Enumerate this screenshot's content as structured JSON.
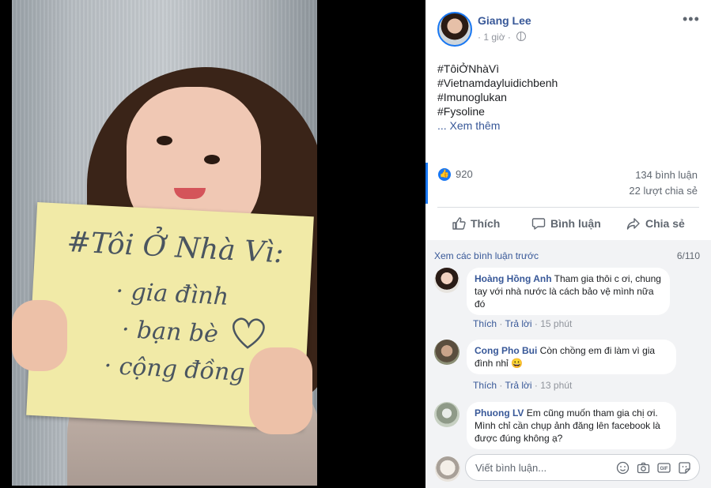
{
  "photo": {
    "sign_lines": [
      "#Tôi Ở Nhà Vì:",
      "· gia đình",
      "· bạn bè",
      "· cộng đồng"
    ]
  },
  "post": {
    "author": "Giang Lee",
    "time": "1 giờ",
    "more_icon": "more-horizontal-icon",
    "hashtags": [
      "#TôiỞNhàVì",
      "#Vietnamdayluidichbenh",
      "#Imunoglukan",
      "#Fysoline"
    ],
    "see_more": "... Xem thêm",
    "reaction_count": "920",
    "comment_count": "134 bình luận",
    "share_count": "22 lượt chia sẻ"
  },
  "actions": {
    "like": "Thích",
    "comment": "Bình luận",
    "share": "Chia sẻ"
  },
  "comments": {
    "view_previous": "Xem các bình luận trước",
    "page_indicator": "6/110",
    "items": [
      {
        "name": "Hoàng Hồng Anh",
        "text": "Tham gia thôi c ơi, chung tay với nhà nước là cách bảo vệ mình nữa đó",
        "like": "Thích",
        "reply": "Trả lời",
        "time": "15 phút"
      },
      {
        "name": "Cong Pho Bui",
        "text": "Còn chồng em đi làm vì gia đình nhỉ",
        "emoji": "😀",
        "like": "Thích",
        "reply": "Trả lời",
        "time": "13 phút"
      },
      {
        "name": "Phuong LV",
        "text": "Em cũng muốn tham gia chị ơi. Mình chỉ cần chụp ảnh đăng lên facebook là được đúng không ạ?"
      }
    ]
  },
  "composer": {
    "placeholder": "Viết bình luận..."
  }
}
